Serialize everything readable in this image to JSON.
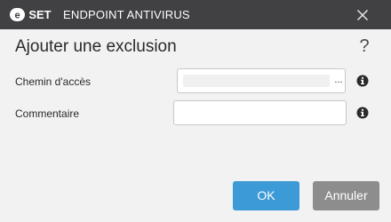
{
  "titlebar": {
    "logo_text": "eset",
    "app_name": "ENDPOINT ANTIVIRUS",
    "close_icon": "close-icon"
  },
  "dialog": {
    "title": "Ajouter une exclusion",
    "help_symbol": "?"
  },
  "form": {
    "path": {
      "label": "Chemin d'accès",
      "value": "",
      "browse_label": "...",
      "info_icon": "info-icon"
    },
    "comment": {
      "label": "Commentaire",
      "value": "",
      "info_icon": "info-icon"
    }
  },
  "buttons": {
    "ok_label": "OK",
    "cancel_label": "Annuler"
  },
  "colors": {
    "titlebar_bg": "#414042",
    "window_bg": "#f2f2f2",
    "ok_button": "#3c9ad7",
    "cancel_button": "#8d8d8d"
  }
}
